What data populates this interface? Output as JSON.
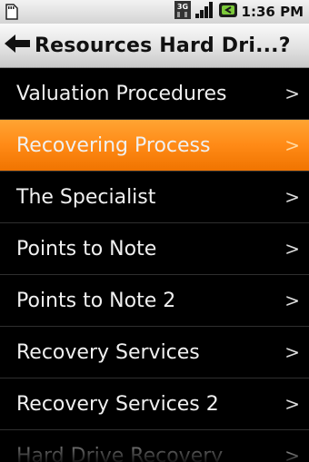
{
  "status_bar": {
    "time": "1:36 PM",
    "network_label": "3G",
    "icons": [
      "sd-card-icon",
      "3g-icon",
      "signal-icon",
      "battery-icon"
    ]
  },
  "title_bar": {
    "title": "Resources Hard Dri...?",
    "back_icon": "back-arrow-icon"
  },
  "menu": {
    "chevron": ">",
    "selected_color": "#ff8a16",
    "items": [
      {
        "label": "Valuation Procedures"
      },
      {
        "label": "Recovering Process"
      },
      {
        "label": "The Specialist"
      },
      {
        "label": "Points to Note"
      },
      {
        "label": "Points to Note 2"
      },
      {
        "label": "Recovery Services"
      },
      {
        "label": "Recovery Services 2"
      },
      {
        "label": "Hard Drive Recovery"
      }
    ]
  }
}
